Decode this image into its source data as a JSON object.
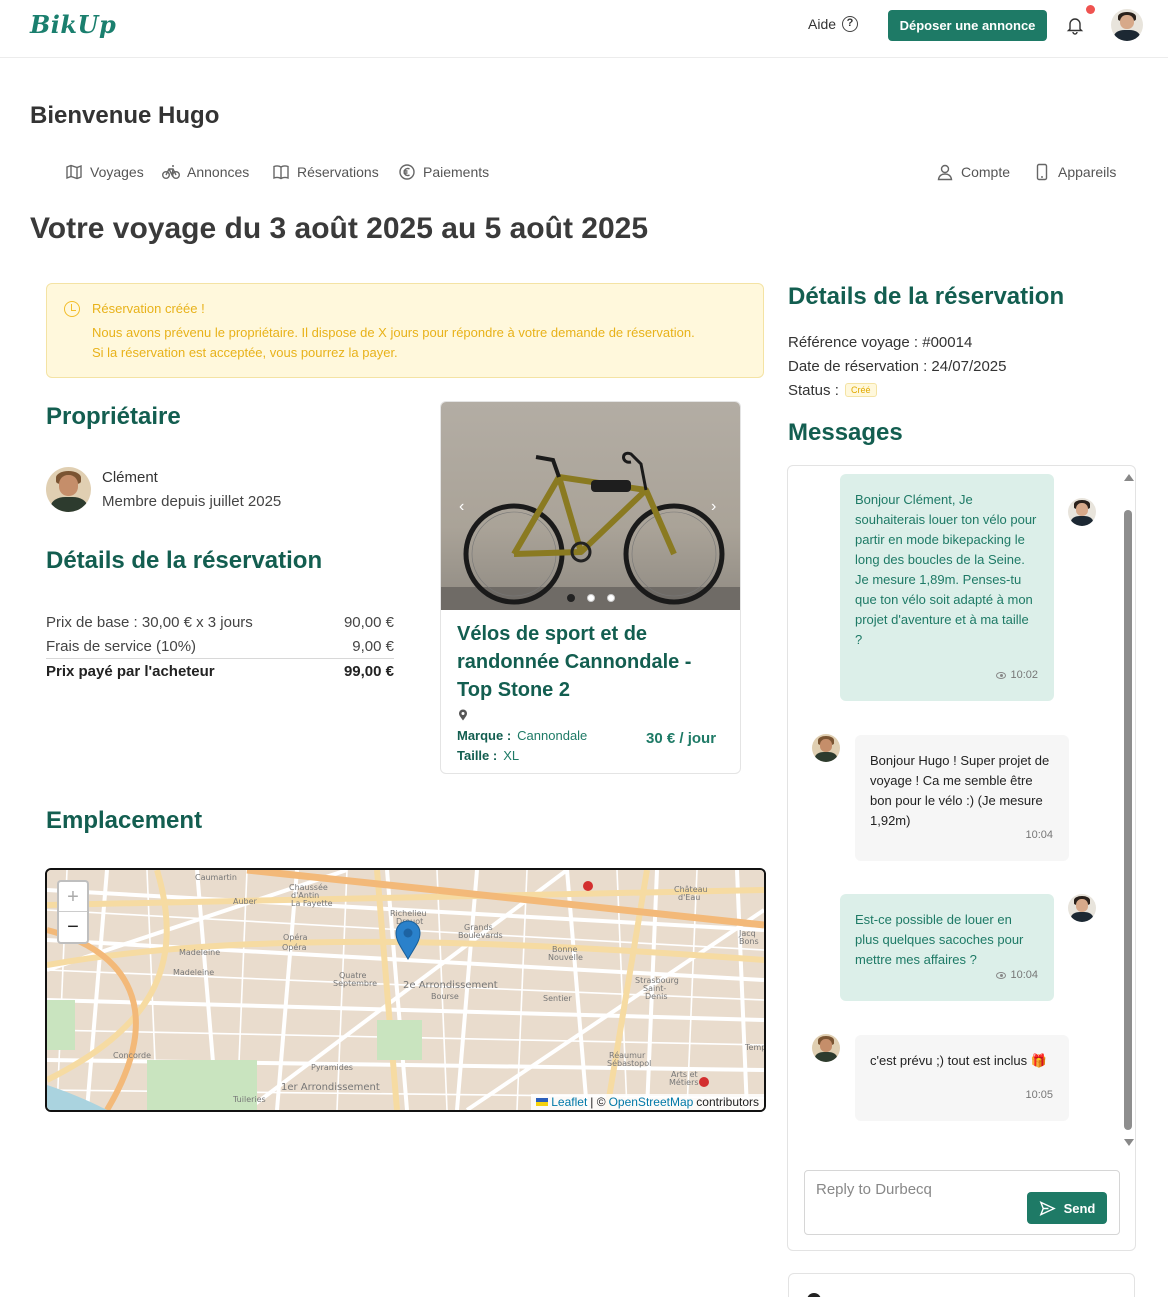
{
  "header": {
    "logo": "BikUp",
    "help_label": "Aide",
    "post_button": "Déposer une annonce",
    "notification_color": "#ef5350",
    "brand_color": "#1e7a66"
  },
  "welcome": "Bienvenue Hugo",
  "tabs_left": [
    {
      "label": "Voyages",
      "icon": "map-icon"
    },
    {
      "label": "Annonces",
      "icon": "bike-icon"
    },
    {
      "label": "Réservations",
      "icon": "book-icon"
    },
    {
      "label": "Paiements",
      "icon": "euro-icon"
    }
  ],
  "tabs_right": [
    {
      "label": "Compte",
      "icon": "user-icon"
    },
    {
      "label": "Appareils",
      "icon": "phone-icon"
    }
  ],
  "trip_title": "Votre voyage du 3 août 2025 au 5 août 2025",
  "alert": {
    "title": "Réservation créée !",
    "line1": "Nous avons prévenu le propriétaire. Il dispose de X jours pour répondre à votre demande de réservation.",
    "line2": "Si la réservation est acceptée, vous pourrez la payer."
  },
  "owner": {
    "heading": "Propriétaire",
    "name": "Clément",
    "since": "Membre depuis juillet 2025"
  },
  "pricing": {
    "heading": "Détails de la réservation",
    "rows": [
      {
        "label": "Prix de base : 30,00 € x 3 jours",
        "value": "90,00 €"
      },
      {
        "label": "Frais de service (10%)",
        "value": "9,00 €"
      }
    ],
    "total_label": "Prix payé par l'acheteur",
    "total_value": "99,00 €"
  },
  "listing": {
    "title": "Vélos de sport et de randonnée Cannondale - Top Stone 2",
    "brand_label": "Marque :",
    "brand": "Cannondale",
    "size_label": "Taille :",
    "size": "XL",
    "price": "30 € / jour",
    "photo_count": 3,
    "active_photo": 1
  },
  "location": {
    "heading": "Emplacement",
    "zoom_in": "+",
    "zoom_out": "−",
    "attribution_leaflet": "Leaflet",
    "attribution_sep": "| ©",
    "attribution_osm": "OpenStreetMap",
    "attribution_tail": "contributors",
    "labels": [
      "Caumartin",
      "Chaussée d'Antin La Fayette",
      "Auber",
      "Madeleine",
      "Opéra",
      "Quatre Septembre",
      "Richelieu Drouot",
      "Grands Boulevards",
      "Bonne Nouvelle",
      "Château d'Eau",
      "Strasbourg Saint-Denis",
      "2e Arrondissement",
      "Bourse",
      "Sentier",
      "Réaumur Sébastopol",
      "Arts et Métiers",
      "Pyramides",
      "Concorde",
      "Tuileries",
      "1er Arrondissement",
      "Jacques Bonsergent",
      "Temple"
    ]
  },
  "details": {
    "heading": "Détails de la réservation",
    "ref_label": "Référence voyage :",
    "ref_value": "#00014",
    "date_label": "Date de réservation :",
    "date_value": "24/07/2025",
    "status_label": "Status :",
    "status_value": "Créé"
  },
  "messages": {
    "heading": "Messages",
    "items": [
      {
        "from": "me",
        "text": "Bonjour Clément, Je souhaiterais louer ton vélo pour partir en mode bikepacking le long des boucles de la Seine. Je mesure 1,89m. Penses-tu que ton vélo soit adapté à mon projet d'aventure et à ma taille ?",
        "time": "10:02"
      },
      {
        "from": "them",
        "text": "Bonjour Hugo ! Super projet de voyage ! Ca me semble être bon pour le vélo :) (Je mesure 1,92m)",
        "time": "10:04"
      },
      {
        "from": "me",
        "text": "Est-ce possible de louer en plus quelques sacoches pour mettre mes affaires ?",
        "time": "10:04"
      },
      {
        "from": "them",
        "text": "c'est prévu ;) tout est inclus 🎁",
        "time": "10:05"
      }
    ],
    "reply_placeholder": "Reply to Durbecq",
    "send_label": "Send"
  }
}
